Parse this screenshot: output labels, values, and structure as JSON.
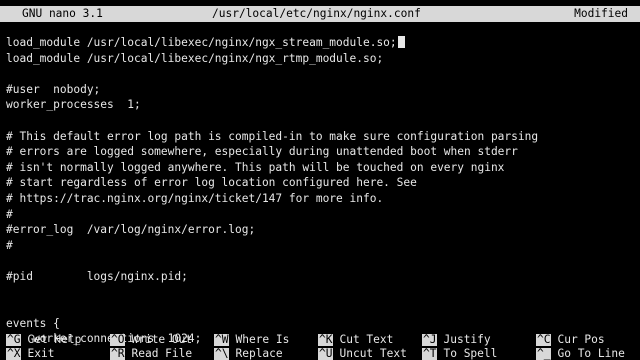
{
  "titlebar": {
    "app": "GNU nano 3.1",
    "filepath": "/usr/local/etc/nginx/nginx.conf",
    "status": "Modified"
  },
  "editor": {
    "lines": [
      "load_module /usr/local/libexec/nginx/ngx_stream_module.so;",
      "load_module /usr/local/libexec/nginx/ngx_rtmp_module.so;",
      "",
      "#user  nobody;",
      "worker_processes  1;",
      "",
      "# This default error log path is compiled-in to make sure configuration parsing",
      "# errors are logged somewhere, especially during unattended boot when stderr",
      "# isn't normally logged anywhere. This path will be touched on every nginx",
      "# start regardless of error log location configured here. See",
      "# https://trac.nginx.org/nginx/ticket/147 for more info.",
      "#",
      "#error_log  /var/log/nginx/error.log;",
      "#",
      "",
      "#pid        logs/nginx.pid;",
      "",
      "",
      "events {",
      "    worker_connections  1024;"
    ]
  },
  "shortcuts": {
    "row1": [
      {
        "key": "^G",
        "label": "Get Help"
      },
      {
        "key": "^O",
        "label": "Write Out"
      },
      {
        "key": "^W",
        "label": "Where Is"
      },
      {
        "key": "^K",
        "label": "Cut Text"
      },
      {
        "key": "^J",
        "label": "Justify"
      },
      {
        "key": "^C",
        "label": "Cur Pos"
      }
    ],
    "row2": [
      {
        "key": "^X",
        "label": "Exit"
      },
      {
        "key": "^R",
        "label": "Read File"
      },
      {
        "key": "^\\",
        "label": "Replace"
      },
      {
        "key": "^U",
        "label": "Uncut Text"
      },
      {
        "key": "^T",
        "label": "To Spell"
      },
      {
        "key": "^_",
        "label": "Go To Line"
      }
    ]
  }
}
